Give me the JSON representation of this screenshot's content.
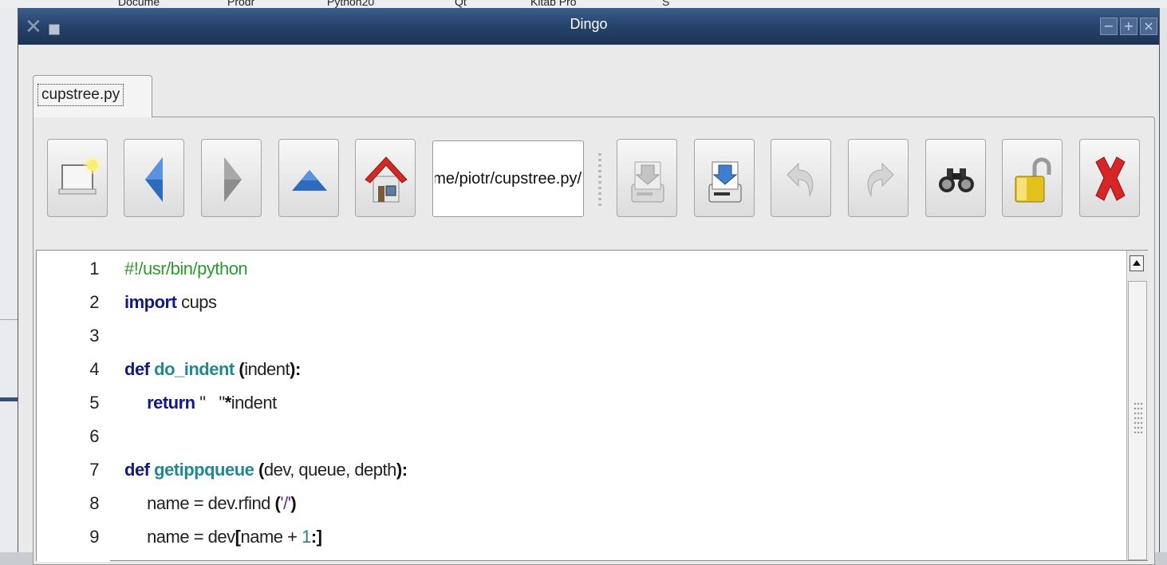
{
  "background": {
    "fragments": [
      "Docume",
      "Prodr",
      "Python20",
      "Qt",
      "Kitab Pro",
      "S"
    ]
  },
  "window": {
    "title": "Dingo",
    "controls": {
      "minimize": "−",
      "maximize": "+",
      "close": "×"
    }
  },
  "tabs": [
    {
      "label": "cupstree.py",
      "active": true
    }
  ],
  "toolbar": {
    "path_value": "/home/piotr/cupstree.py",
    "buttons": [
      {
        "name": "new-document-button",
        "icon": "new-document-icon"
      },
      {
        "name": "back-button",
        "icon": "arrow-left-icon"
      },
      {
        "name": "forward-button",
        "icon": "arrow-right-icon"
      },
      {
        "name": "up-button",
        "icon": "arrow-up-icon"
      },
      {
        "name": "home-button",
        "icon": "home-icon"
      },
      {
        "name": "save-button",
        "icon": "save-drive-icon"
      },
      {
        "name": "save-as-button",
        "icon": "save-as-drive-icon"
      },
      {
        "name": "undo-button",
        "icon": "undo-icon"
      },
      {
        "name": "redo-button",
        "icon": "redo-icon"
      },
      {
        "name": "find-button",
        "icon": "binoculars-icon"
      },
      {
        "name": "unlock-button",
        "icon": "padlock-icon"
      },
      {
        "name": "close-file-button",
        "icon": "red-x-icon"
      }
    ]
  },
  "editor": {
    "line_numbers": [
      "1",
      "2",
      "3",
      "4",
      "5",
      "6",
      "7",
      "8",
      "9"
    ],
    "lines": {
      "l1": {
        "comment": "#!/usr/bin/python"
      },
      "l2": {
        "kw": "import",
        "rest": " cups"
      },
      "l4": {
        "kw": "def",
        "fn": "do_indent",
        "p1": " (",
        "args": "indent",
        "p2": "):"
      },
      "l5": {
        "kw": "return",
        "str": " \"   \"",
        "op": "*",
        "rest": "indent"
      },
      "l7": {
        "kw": "def",
        "fn": "getippqueue",
        "p1": " (",
        "args": "dev, queue, depth",
        "p2": "):"
      },
      "l8": {
        "a": "name = dev.",
        "b": "rfind ",
        "p1": "(",
        "str": "'/'",
        "p2": ")"
      },
      "l9": {
        "a": "name = dev",
        "p1": "[",
        "b": "name + ",
        "num": "1",
        "p2": ":]"
      }
    }
  },
  "colors": {
    "titlebar": "#27446d",
    "keyword": "#111a80",
    "function": "#22888f",
    "comment": "#2e9a2e",
    "string": "#6a2a86"
  }
}
